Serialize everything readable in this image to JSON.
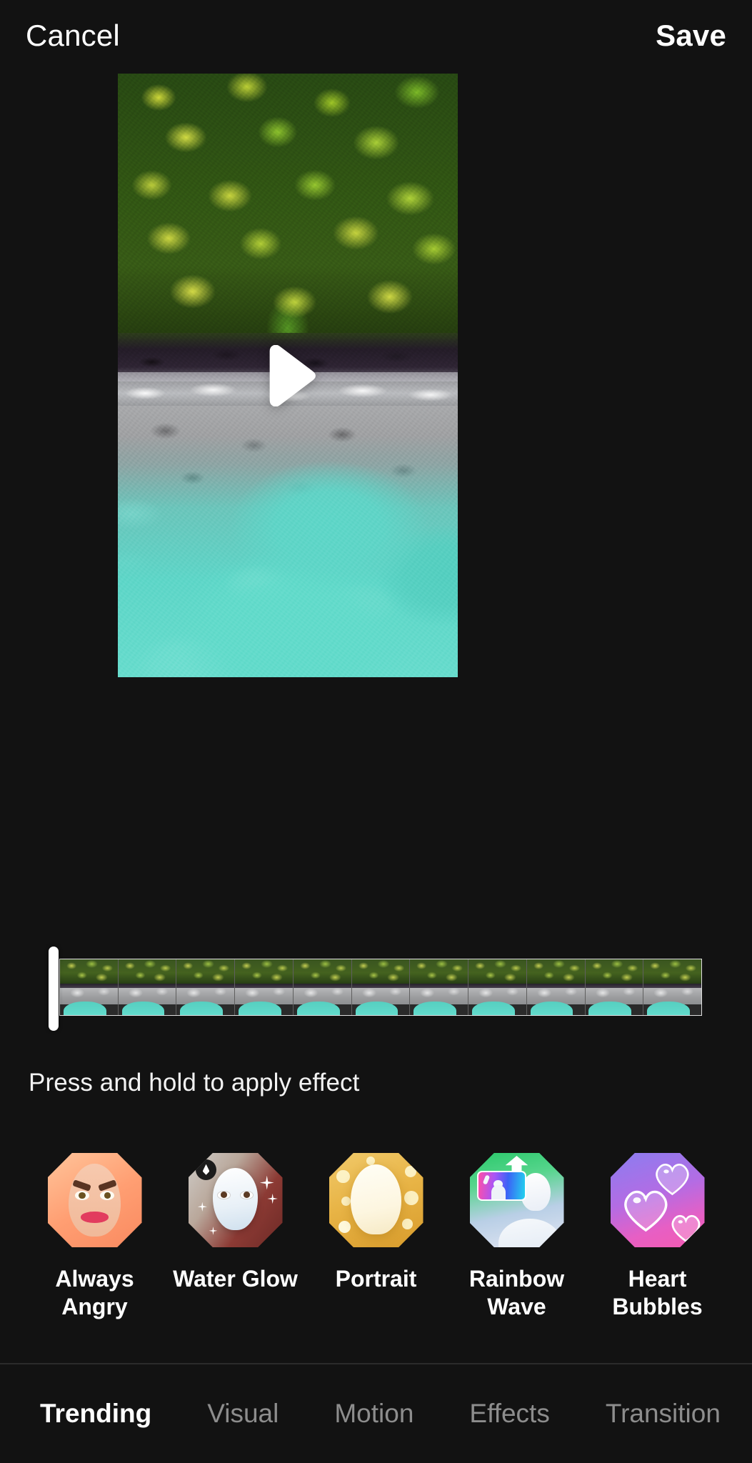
{
  "header": {
    "cancel_label": "Cancel",
    "save_label": "Save"
  },
  "preview": {
    "play_icon": "play-icon",
    "scene_description": "Aerial drone view of tropical palm canopy, volcanic shoreline and turquoise lagoon"
  },
  "timeline": {
    "frame_count": 11,
    "playhead_position_percent": 0,
    "handle_icon": "playhead-handle"
  },
  "hint": {
    "text": "Press and hold to apply effect"
  },
  "effects": {
    "items": [
      {
        "label": "Always\nAngry",
        "label_line1": "Always",
        "label_line2": "Angry",
        "icon": "angry-face-icon",
        "accent": "#ff9e72"
      },
      {
        "label": "Water Glow",
        "label_line1": "Water Glow",
        "label_line2": "",
        "icon": "water-mask-icon",
        "accent": "#8c3a34"
      },
      {
        "label": "Portrait",
        "label_line1": "Portrait",
        "label_line2": "",
        "icon": "portrait-glow-icon",
        "accent": "#e8b446"
      },
      {
        "label": "Rainbow\nWave",
        "label_line1": "Rainbow",
        "label_line2": "Wave",
        "icon": "rainbow-wave-icon",
        "accent": "#2bc96b"
      },
      {
        "label": "Heart\nBubbles",
        "label_line1": "Heart",
        "label_line2": "Bubbles",
        "icon": "heart-bubbles-icon",
        "accent": "#e75fc4"
      }
    ]
  },
  "tabs": {
    "items": [
      {
        "label": "Trending",
        "active": true
      },
      {
        "label": "Visual",
        "active": false
      },
      {
        "label": "Motion",
        "active": false
      },
      {
        "label": "Effects",
        "active": false
      },
      {
        "label": "Transition",
        "active": false
      }
    ]
  },
  "colors": {
    "background": "#121212",
    "text_primary": "#ffffff",
    "text_muted": "#8d8d8d",
    "separator": "#2b2b2b",
    "lagoon": "#5fd6c8"
  }
}
